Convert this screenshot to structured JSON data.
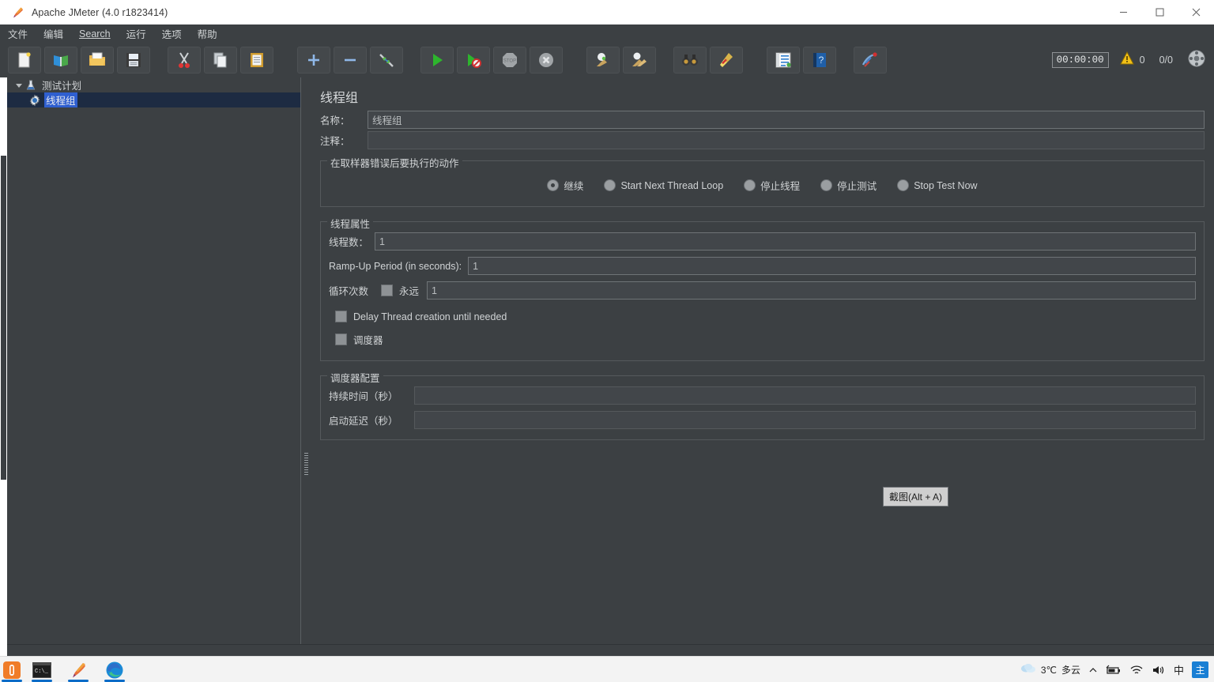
{
  "window": {
    "title": "Apache JMeter (4.0 r1823414)",
    "app_icon": "jmeter-feather-icon",
    "controls": {
      "minimize": "—",
      "maximize": "□",
      "close": "✕"
    }
  },
  "menubar": {
    "items": [
      {
        "label": "文件",
        "name": "menu-file"
      },
      {
        "label": "编辑",
        "name": "menu-edit"
      },
      {
        "label": "Search",
        "name": "menu-search",
        "mnemonic": "S"
      },
      {
        "label": "运行",
        "name": "menu-run"
      },
      {
        "label": "选项",
        "name": "menu-options"
      },
      {
        "label": "帮助",
        "name": "menu-help"
      }
    ]
  },
  "toolbar": {
    "buttons": [
      {
        "icon": "new-document-icon",
        "name": "toolbar-new"
      },
      {
        "icon": "templates-icon",
        "name": "toolbar-templates"
      },
      {
        "icon": "open-folder-icon",
        "name": "toolbar-open"
      },
      {
        "icon": "save-floppy-icon",
        "name": "toolbar-save"
      },
      {
        "icon": "cut-scissors-icon",
        "name": "toolbar-cut"
      },
      {
        "icon": "copy-pages-icon",
        "name": "toolbar-copy"
      },
      {
        "icon": "paste-clipboard-icon",
        "name": "toolbar-paste"
      },
      {
        "icon": "plus-icon",
        "name": "toolbar-expand-all"
      },
      {
        "icon": "minus-icon",
        "name": "toolbar-collapse-all"
      },
      {
        "icon": "toggle-icon",
        "name": "toolbar-toggle"
      },
      {
        "icon": "start-play-icon",
        "name": "toolbar-start"
      },
      {
        "icon": "start-no-pauses-icon",
        "name": "toolbar-start-no-pauses"
      },
      {
        "icon": "stop-icon",
        "name": "toolbar-stop"
      },
      {
        "icon": "shutdown-icon",
        "name": "toolbar-shutdown"
      },
      {
        "icon": "clear-icon",
        "name": "toolbar-clear"
      },
      {
        "icon": "clear-all-icon",
        "name": "toolbar-clear-all"
      },
      {
        "icon": "search-binoculars-icon",
        "name": "toolbar-search"
      },
      {
        "icon": "reset-search-broom-icon",
        "name": "toolbar-search-reset"
      },
      {
        "icon": "function-helper-icon",
        "name": "toolbar-function-helper"
      },
      {
        "icon": "help-book-icon",
        "name": "toolbar-help"
      },
      {
        "icon": "undo-redo-icon",
        "name": "toolbar-extra"
      }
    ],
    "timer": "00:00:00",
    "warning_count": "0",
    "thread_counts": "0/0",
    "warning_icon": "warning-triangle-icon",
    "remote_icon": "remote-engines-icon"
  },
  "tree": {
    "nodes": [
      {
        "label": "测试计划",
        "icon": "test-plan-icon",
        "expanded": true,
        "selected": false,
        "name": "tree-node-test-plan"
      },
      {
        "label": "线程组",
        "icon": "thread-group-gear-icon",
        "expanded": false,
        "selected": true,
        "name": "tree-node-thread-group"
      }
    ]
  },
  "panel": {
    "title": "线程组",
    "name_label": "名称：",
    "name_value": "线程组",
    "comment_label": "注释：",
    "comment_value": "",
    "error_action": {
      "legend": "在取样器错误后要执行的动作",
      "options": [
        {
          "label": "继续",
          "selected": true,
          "name": "radio-continue"
        },
        {
          "label": "Start Next Thread Loop",
          "selected": false,
          "name": "radio-start-next-thread-loop"
        },
        {
          "label": "停止线程",
          "selected": false,
          "name": "radio-stop-thread"
        },
        {
          "label": "停止测试",
          "selected": false,
          "name": "radio-stop-test"
        },
        {
          "label": "Stop Test Now",
          "selected": false,
          "name": "radio-stop-test-now"
        }
      ]
    },
    "thread_properties": {
      "legend": "线程属性",
      "num_threads_label": "线程数：",
      "num_threads_value": "1",
      "ramp_up_label": "Ramp-Up Period (in seconds):",
      "ramp_up_value": "1",
      "loop_count_label": "循环次数",
      "forever_label": "永远",
      "forever_checked": false,
      "loop_count_value": "1",
      "delay_thread_label": "Delay Thread creation until needed",
      "delay_thread_checked": false,
      "scheduler_label": "调度器",
      "scheduler_checked": false
    },
    "scheduler_config": {
      "legend": "调度器配置",
      "duration_label": "持续时间（秒）",
      "duration_value": "",
      "startup_delay_label": "启动延迟（秒）",
      "startup_delay_value": ""
    }
  },
  "tooltip": {
    "text": "截图(Alt + A)"
  },
  "taskbar": {
    "items": [
      {
        "icon": "app-orange-icon",
        "name": "taskbar-app-orange",
        "active": true
      },
      {
        "icon": "terminal-icon",
        "name": "taskbar-terminal",
        "active": true
      },
      {
        "icon": "jmeter-feather-icon",
        "name": "taskbar-jmeter",
        "active": true
      },
      {
        "icon": "edge-browser-icon",
        "name": "taskbar-edge",
        "active": true
      }
    ],
    "tray": {
      "weather_icon": "cloud-icon",
      "temperature": "3℃",
      "weather_text": "多云",
      "chevron": "⌃",
      "battery_icon": "battery-icon",
      "wifi_icon": "wifi-icon",
      "volume_icon": "volume-icon",
      "ime_text": "中",
      "ime_app_text": "主"
    }
  },
  "colors": {
    "app_background": "#3c4043",
    "panel_background": "#3c4043",
    "field_background": "#42464a",
    "selection_blue": "#2f5fd0",
    "selection_row": "#1d2b42",
    "text": "#d0d3d5",
    "taskbar_accent": "#0a6cc7"
  }
}
